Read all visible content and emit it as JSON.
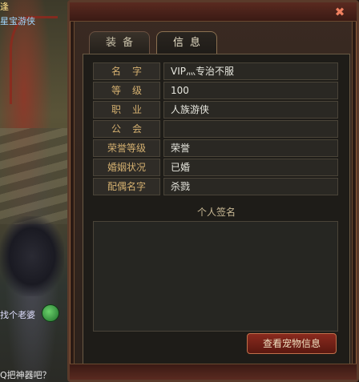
{
  "scene": {
    "text_top": "逢",
    "text_name": "星宝游侠",
    "text_chat": "找个老婆",
    "text_bottom": "Q把神器吧？"
  },
  "window": {
    "close_label": "✖",
    "tabs": [
      {
        "label": "装备",
        "active": false
      },
      {
        "label": "信息",
        "active": true
      }
    ]
  },
  "info": {
    "rows": [
      {
        "label": "名字",
        "value": "VIP灬专治不服"
      },
      {
        "label": "等级",
        "value": "100"
      },
      {
        "label": "职业",
        "value": "人族游侠"
      },
      {
        "label": "公会",
        "value": ""
      },
      {
        "label": "荣誉等级",
        "value": "荣誉"
      },
      {
        "label": "婚姻状况",
        "value": "已婚"
      },
      {
        "label": "配偶名字",
        "value": "杀戮"
      }
    ],
    "signature_title": "个人签名",
    "signature_text": ""
  },
  "buttons": {
    "view_pet_label": "查看宠物信息"
  },
  "colors": {
    "label_text": "#d4b070",
    "value_text": "#e8e8e0",
    "button_bg": "#8a2a1e"
  }
}
